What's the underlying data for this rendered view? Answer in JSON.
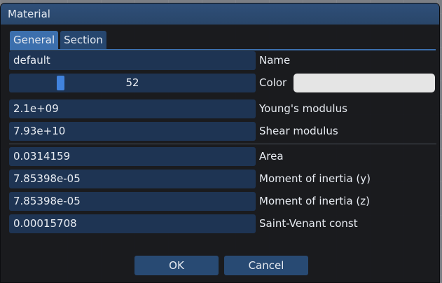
{
  "window": {
    "title": "Material"
  },
  "tabs": [
    {
      "label": "General",
      "active": true
    },
    {
      "label": "Section",
      "active": false
    }
  ],
  "general": {
    "name": {
      "value": "default",
      "label": "Name"
    },
    "color": {
      "slider_value": "52",
      "slider_fraction": 0.2,
      "label": "Color",
      "swatch_color": "#e5e5e5"
    },
    "youngs_modulus": {
      "value": "2.1e+09",
      "label": "Young's modulus"
    },
    "shear_modulus": {
      "value": "7.93e+10",
      "label": "Shear modulus"
    }
  },
  "section": {
    "area": {
      "value": "0.0314159",
      "label": "Area"
    },
    "moment_y": {
      "value": "7.85398e-05",
      "label": "Moment of inertia (y)"
    },
    "moment_z": {
      "value": "7.85398e-05",
      "label": "Moment of inertia (z)"
    },
    "saint_venant": {
      "value": "0.00015708",
      "label": "Saint-Venant const"
    }
  },
  "buttons": {
    "ok": "OK",
    "cancel": "Cancel"
  },
  "colors": {
    "titlebar": "#2c4b73",
    "field_bg": "#1e3453",
    "accent": "#3c6fad",
    "slider_thumb": "#4183de"
  }
}
